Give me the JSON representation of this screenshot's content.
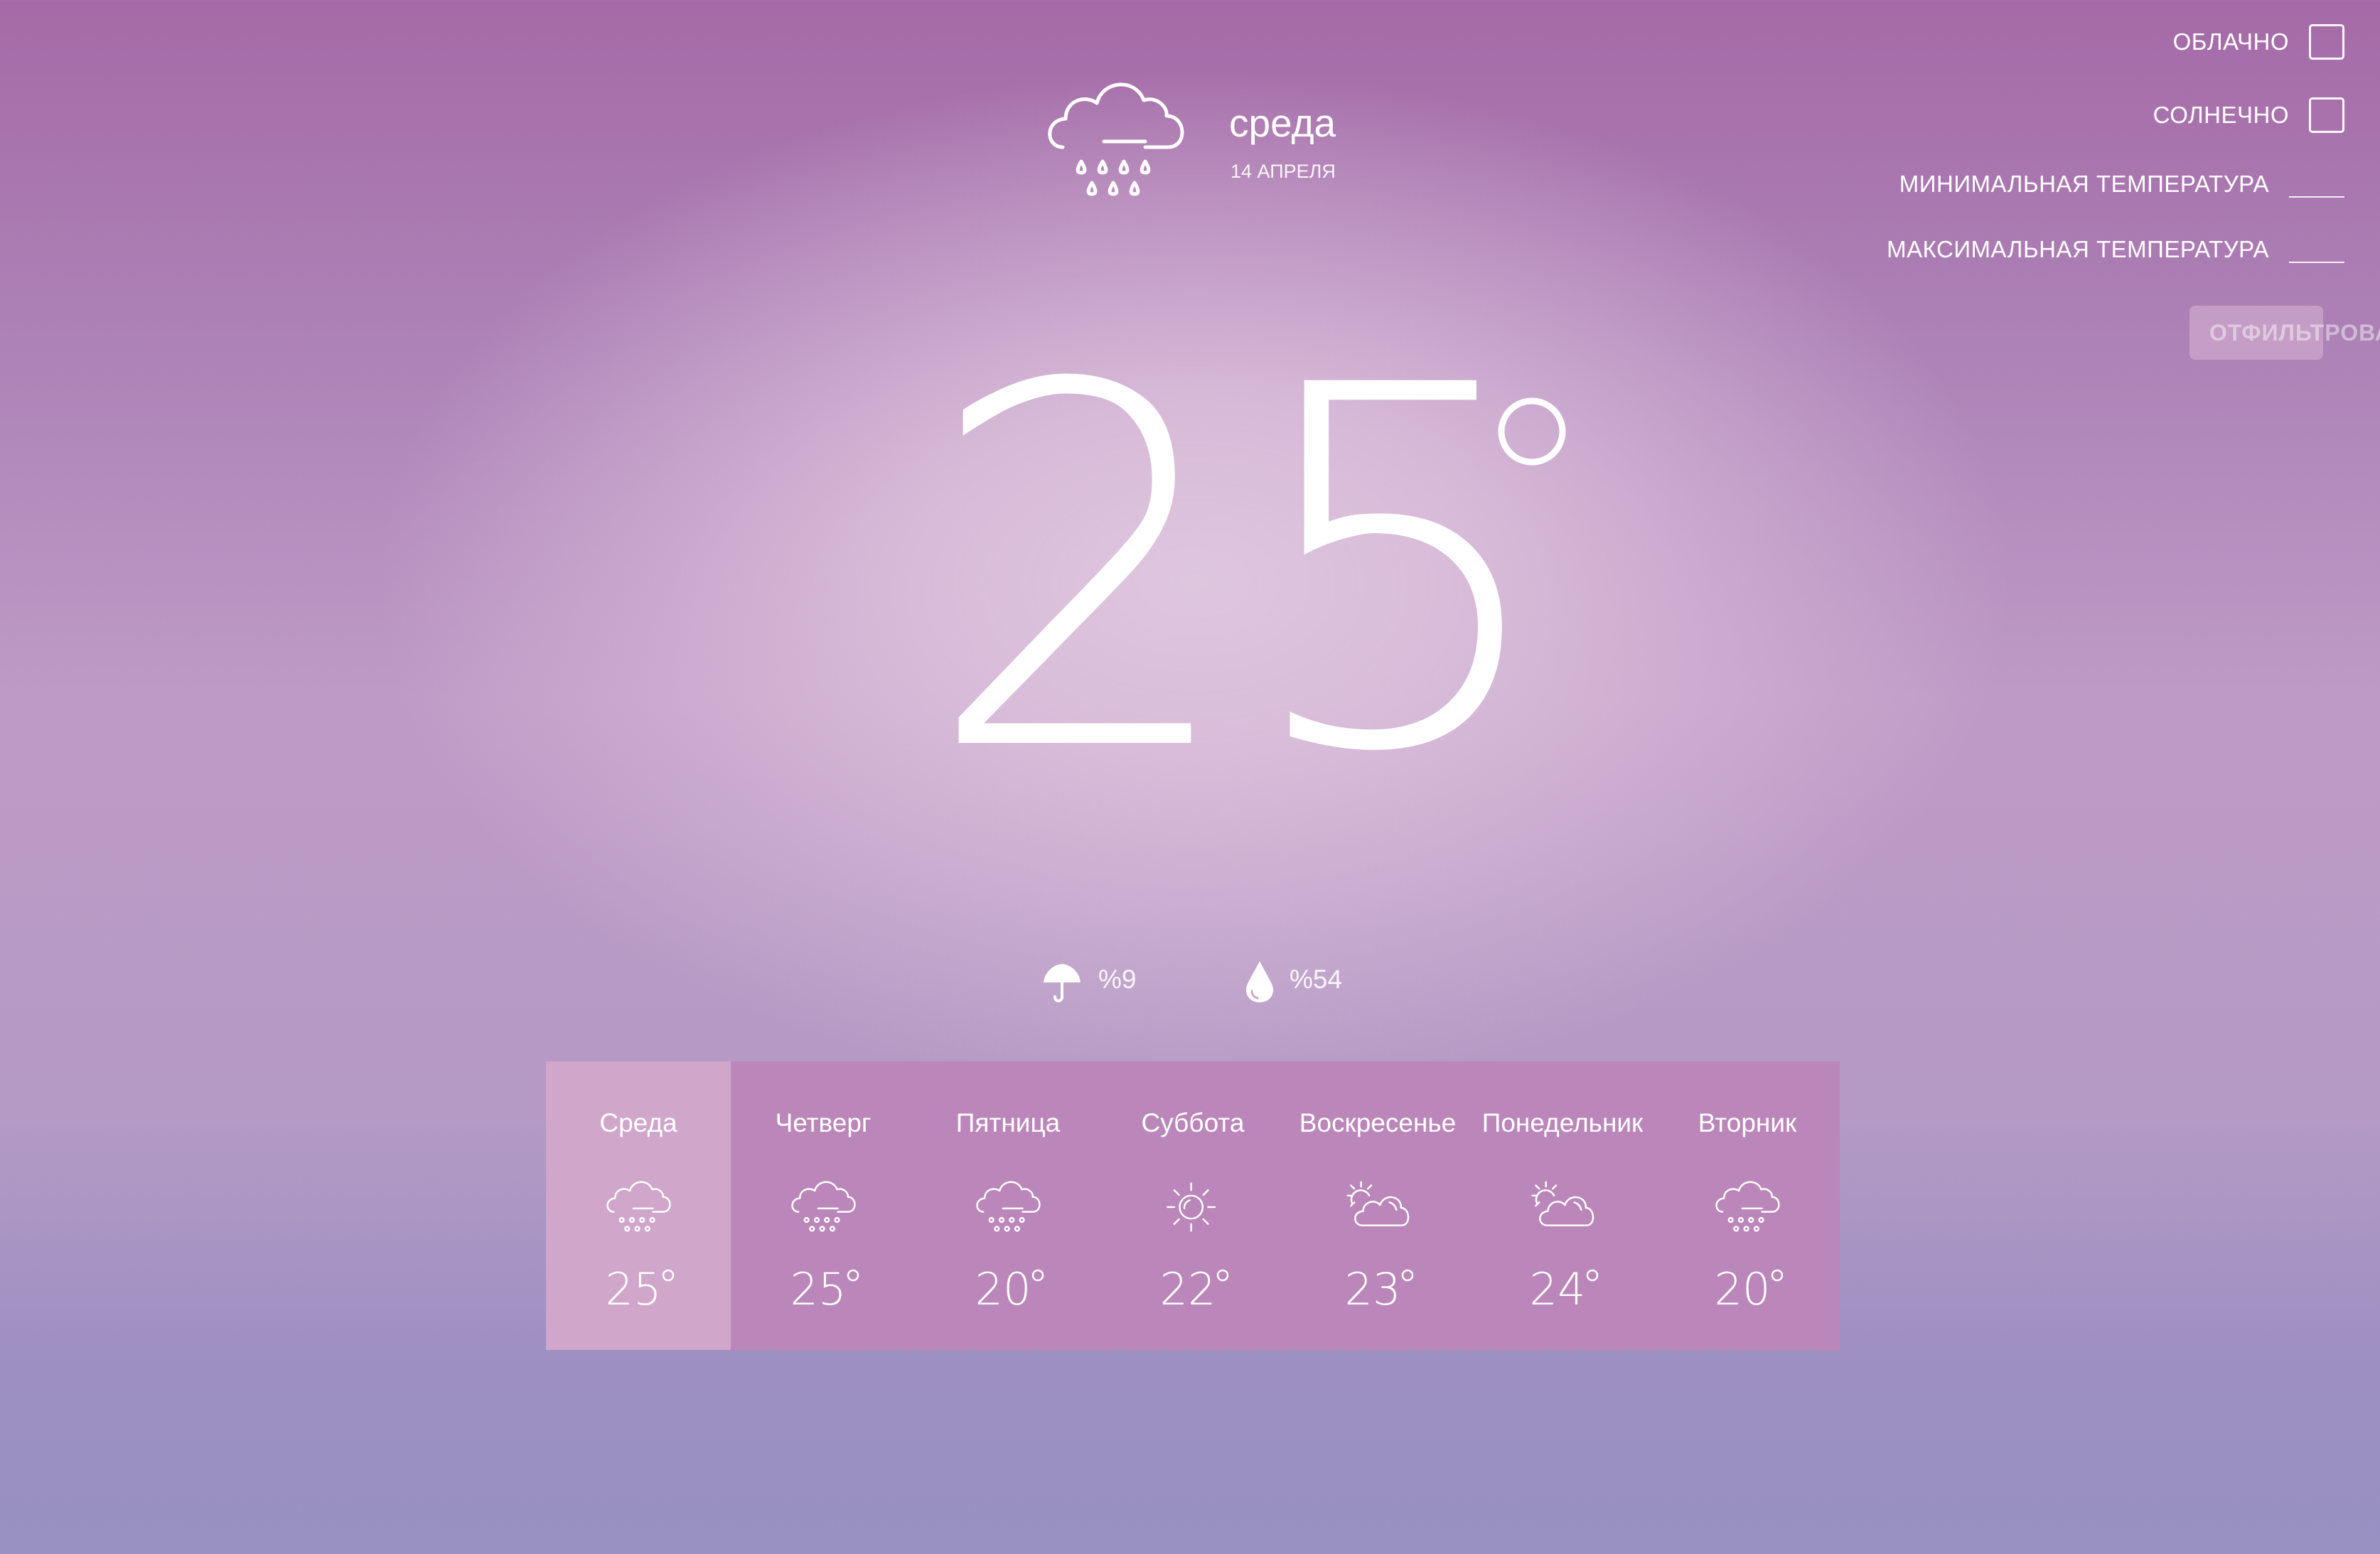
{
  "filters": {
    "cloudy_label": "ОБЛАЧНО",
    "sunny_label": "СОЛНЕЧНО",
    "min_temp_label": "МИНИМАЛЬНАЯ ТЕМПЕРАТУРА",
    "max_temp_label": "МАКСИМАЛЬНАЯ ТЕМПЕРАТУРА",
    "min_temp_value": "",
    "max_temp_value": "",
    "button_label": "ОТФИЛЬТРОВАТЬ"
  },
  "current": {
    "icon": "rain-cloud-icon",
    "day": "среда",
    "date": "14 АПРЕЛЯ",
    "temperature": "25",
    "precipitation": "%9",
    "humidity": "%54"
  },
  "forecast": [
    {
      "day": "Среда",
      "icon": "rain-cloud-icon",
      "temp": "25",
      "active": true
    },
    {
      "day": "Четверг",
      "icon": "rain-cloud-icon",
      "temp": "25",
      "active": false
    },
    {
      "day": "Пятница",
      "icon": "rain-cloud-icon",
      "temp": "20",
      "active": false
    },
    {
      "day": "Суббота",
      "icon": "sun-icon",
      "temp": "22",
      "active": false
    },
    {
      "day": "Воскресенье",
      "icon": "partly-cloudy-icon",
      "temp": "23",
      "active": false
    },
    {
      "day": "Понедельник",
      "icon": "partly-cloudy-icon",
      "temp": "24",
      "active": false
    },
    {
      "day": "Вторник",
      "icon": "rain-cloud-icon",
      "temp": "20",
      "active": false
    }
  ],
  "colors": {
    "forecast_bg": "#bb86b9",
    "forecast_active_bg": "#d0a6cb",
    "text": "#ffffff"
  }
}
